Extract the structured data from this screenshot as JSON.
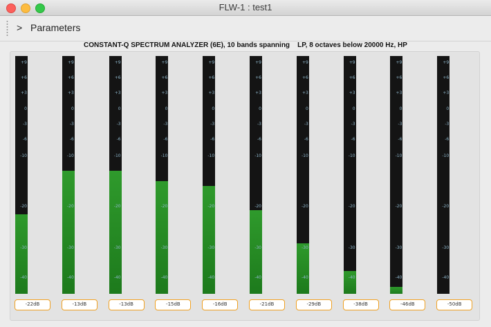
{
  "window": {
    "title": "FLW-1 : test1"
  },
  "toolbar": {
    "chevron": ">",
    "label": "Parameters"
  },
  "analyzer": {
    "title": "CONSTANT-Q SPECTRUM ANALYZER (6E), 10 bands spanning    LP, 8 octaves below 20000 Hz, HP",
    "scale_labels": [
      "+9",
      "+6",
      "+3",
      "0",
      "-3",
      "-6",
      "-10",
      "-20",
      "-30",
      "-40"
    ],
    "bands": [
      {
        "readout": "-22dB",
        "level_db": -22
      },
      {
        "readout": "-13dB",
        "level_db": -13
      },
      {
        "readout": "-13dB",
        "level_db": -13
      },
      {
        "readout": "-15dB",
        "level_db": -15
      },
      {
        "readout": "-16dB",
        "level_db": -16
      },
      {
        "readout": "-21dB",
        "level_db": -21
      },
      {
        "readout": "-29dB",
        "level_db": -29
      },
      {
        "readout": "-38dB",
        "level_db": -38
      },
      {
        "readout": "-46dB",
        "level_db": -46
      },
      {
        "readout": "-50dB",
        "level_db": -50
      }
    ]
  },
  "colors": {
    "meter_bg": "#141414",
    "meter_fill": "#2a8f28",
    "readout_border": "#f0a020",
    "tick_text": "#8fb7cc"
  }
}
